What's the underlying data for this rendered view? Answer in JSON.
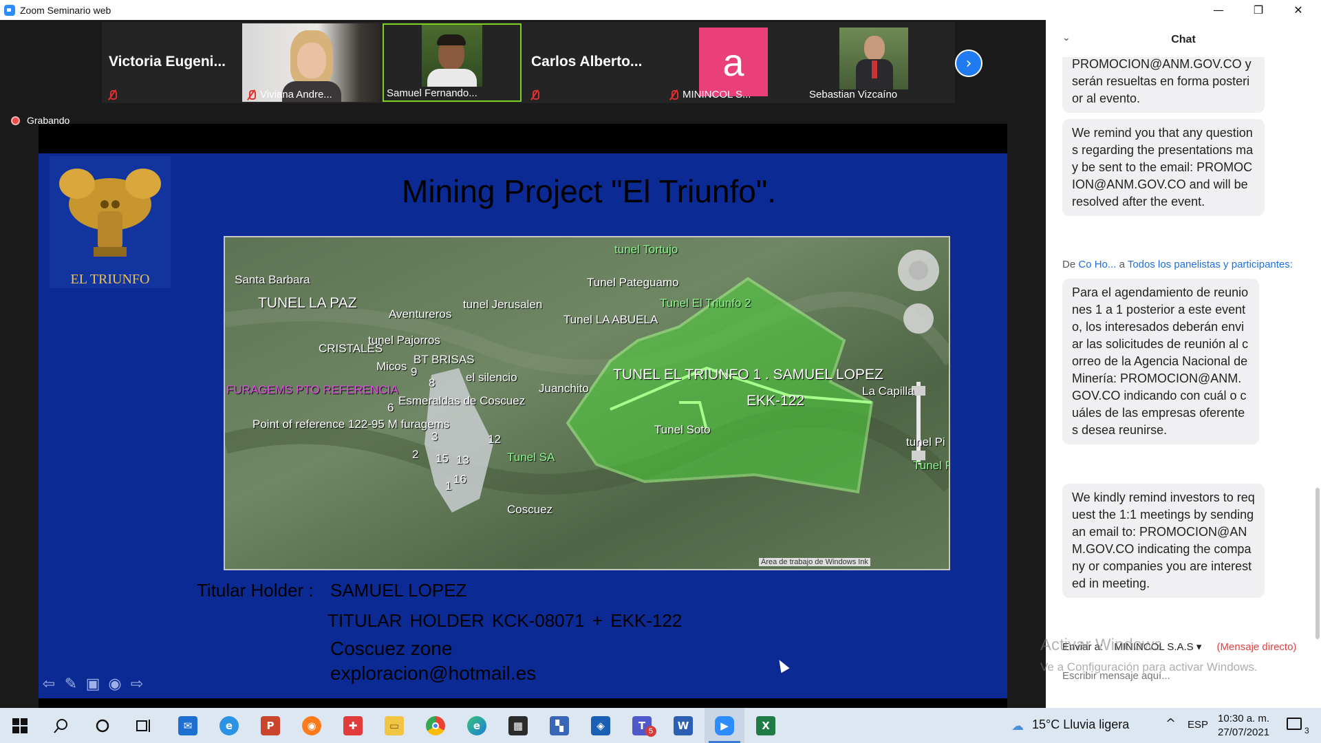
{
  "window": {
    "title": "Zoom Seminario web",
    "controls": {
      "minimize": "—",
      "maximize": "❐",
      "close": "✕"
    }
  },
  "participants": [
    {
      "name": "Victoria  Eugeni...",
      "video": false,
      "muted": true
    },
    {
      "name": "Viviana Andre...",
      "video": true,
      "muted": true
    },
    {
      "name": "Samuel Fernando...",
      "video": true,
      "muted": false,
      "active_speaker": true
    },
    {
      "name": "Carlos  Alberto...",
      "video": false,
      "muted": true
    },
    {
      "name": "MININCOL S...",
      "video": false,
      "muted": true,
      "avatar_letter": "a",
      "avatar_color": "#e9407a"
    },
    {
      "name": "Sebastian Vizcaíno",
      "video": true,
      "muted": false
    }
  ],
  "recording": {
    "label": "Grabando"
  },
  "slide": {
    "logo_text": "EL TRIUNFO",
    "title": "Mining  Project \"El Triunfo\".",
    "map_labels": [
      "tunel Tortujo",
      "Santa Barbara",
      "Tunel Pateguamo",
      "TUNEL LA PAZ",
      "tunel Jerusalen",
      "Tunel El Triunfo 2",
      "Aventureros",
      "Tunel LA ABUELA",
      "tunel Pajorros",
      "CRISTALES",
      "BT BRISAS",
      "Micos",
      "9",
      "el silencio",
      "TUNEL EL TRIUNFO 1 . SAMUEL LOPEZ",
      "FURAGEMS PTO REFERENCIA",
      "8",
      "Juanchito",
      "La Capilla",
      "6",
      "Esmeraldas de Coscuez",
      "EKK-122",
      "Point of reference   122-95 M furagems",
      "Tunel Soto",
      "3",
      "12",
      "tunel Pi",
      "2",
      "15",
      "13",
      "Tunel SA",
      "Tunel Pequ",
      "16",
      "1",
      "Coscuez",
      "Área de trabajo de Windows Ink"
    ],
    "titular_label": "Titular Holder :",
    "titular_name": "SAMUEL LOPEZ",
    "titular_line": "TITULAR HOLDER     KCK-08071   +  EKK-122",
    "zone": "Coscuez zone",
    "email": "exploracion@hotmail.es",
    "controls": [
      "⇦",
      "✎",
      "▣",
      "◉",
      "⇨"
    ]
  },
  "chat": {
    "header": "Chat",
    "messages": [
      {
        "text": "PROMOCION@ANM.GOV.CO y serán resueltas en forma posterior al evento."
      },
      {
        "text": "We remind you that any questions regarding the presentations may be sent to the email: PROMOCION@ANM.GOV.CO and will be resolved after the event."
      },
      {
        "text": "Para el agendamiento de reuniones 1 a 1 posterior a este evento, los interesados deberán enviar las solicitudes de reunión al correo de la Agencia Nacional de Minería: PROMOCION@ANM.GOV.CO indicando con cuál o cuáles de las empresas oferentes desea reunirse."
      },
      {
        "text": "We kindly remind investors to request the 1:1 meetings by sending an email to: PROMOCION@ANM.GOV.CO indicating the company or companies you are interested in meeting."
      }
    ],
    "sender_prefix": "De",
    "sender_name": "Co Ho...",
    "sender_mid": "a",
    "sender_target": "Todos los panelistas y participantes:",
    "send_to_label": "Enviar a:",
    "send_to_value": "MININCOL S.A.S ▾",
    "direct_label": "(Mensaje directo)",
    "input_placeholder": "Escribir mensaje aquí..."
  },
  "watermark": {
    "line1": "Activar Windows",
    "line2": "Ve a Configuración para activar Windows."
  },
  "taskbar": {
    "weather": "15°C  Lluvia ligera",
    "lang": "ESP",
    "time": "10:30 a. m.",
    "date": "27/07/2021",
    "notif_count": "3",
    "teams_badge": "5"
  }
}
